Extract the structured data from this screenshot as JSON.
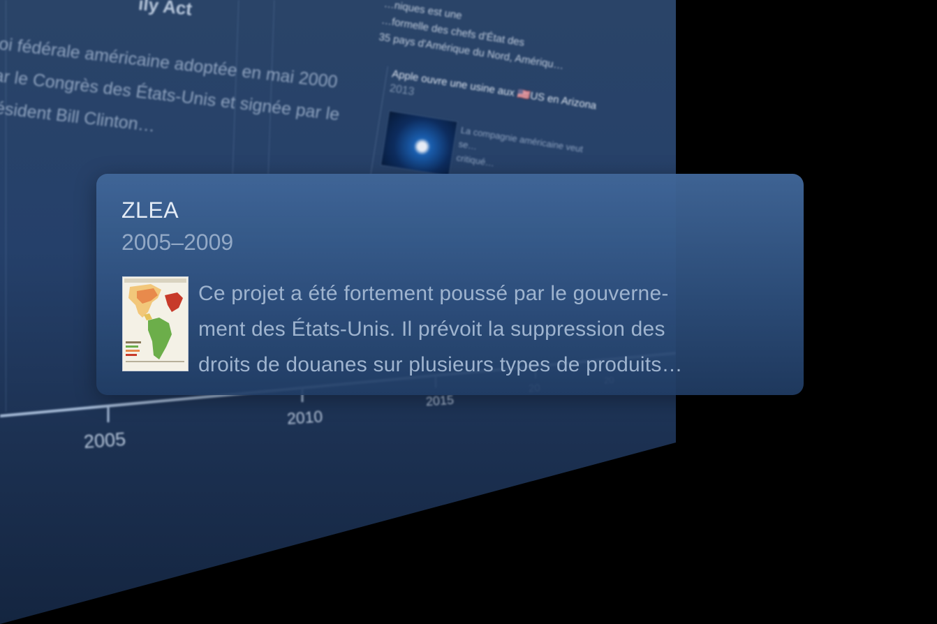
{
  "timeline_panel": {
    "event_title": "ily Act",
    "event_description": "oi fédérale américaine adoptée en mai 2000\nar le Congrès des États-Unis et signée par le\nrésident Bill Clinton…",
    "side_snippet": "…niques est une\n…formelle des chefs d'État des\n35 pays d'Amérique du Nord, Amériqu…",
    "card": {
      "title": "Apple ouvre une usine aux 🇺🇸US en Arizona",
      "year": "2013",
      "description": "La compagnie américaine veut se…\ncritiqué…"
    },
    "axis_ticks": [
      "2005",
      "2010",
      "2015",
      "20",
      "20"
    ]
  },
  "tooltip": {
    "title": "ZLEA",
    "dates": "2005–2009",
    "thumbnail_icon": "americas-map-thumbnail",
    "description": "Ce projet a été fortement poussé par le gouverne-\nment des États-Unis. Il prévoit la suppression des\ndroits de douanes sur plusieurs types de produits…"
  },
  "colors": {
    "background": "#000000",
    "panel": "#25406a",
    "tooltip": "#3e6494",
    "tooltip_title": "#e3ebf5",
    "tooltip_text": "#9fb4cf"
  }
}
